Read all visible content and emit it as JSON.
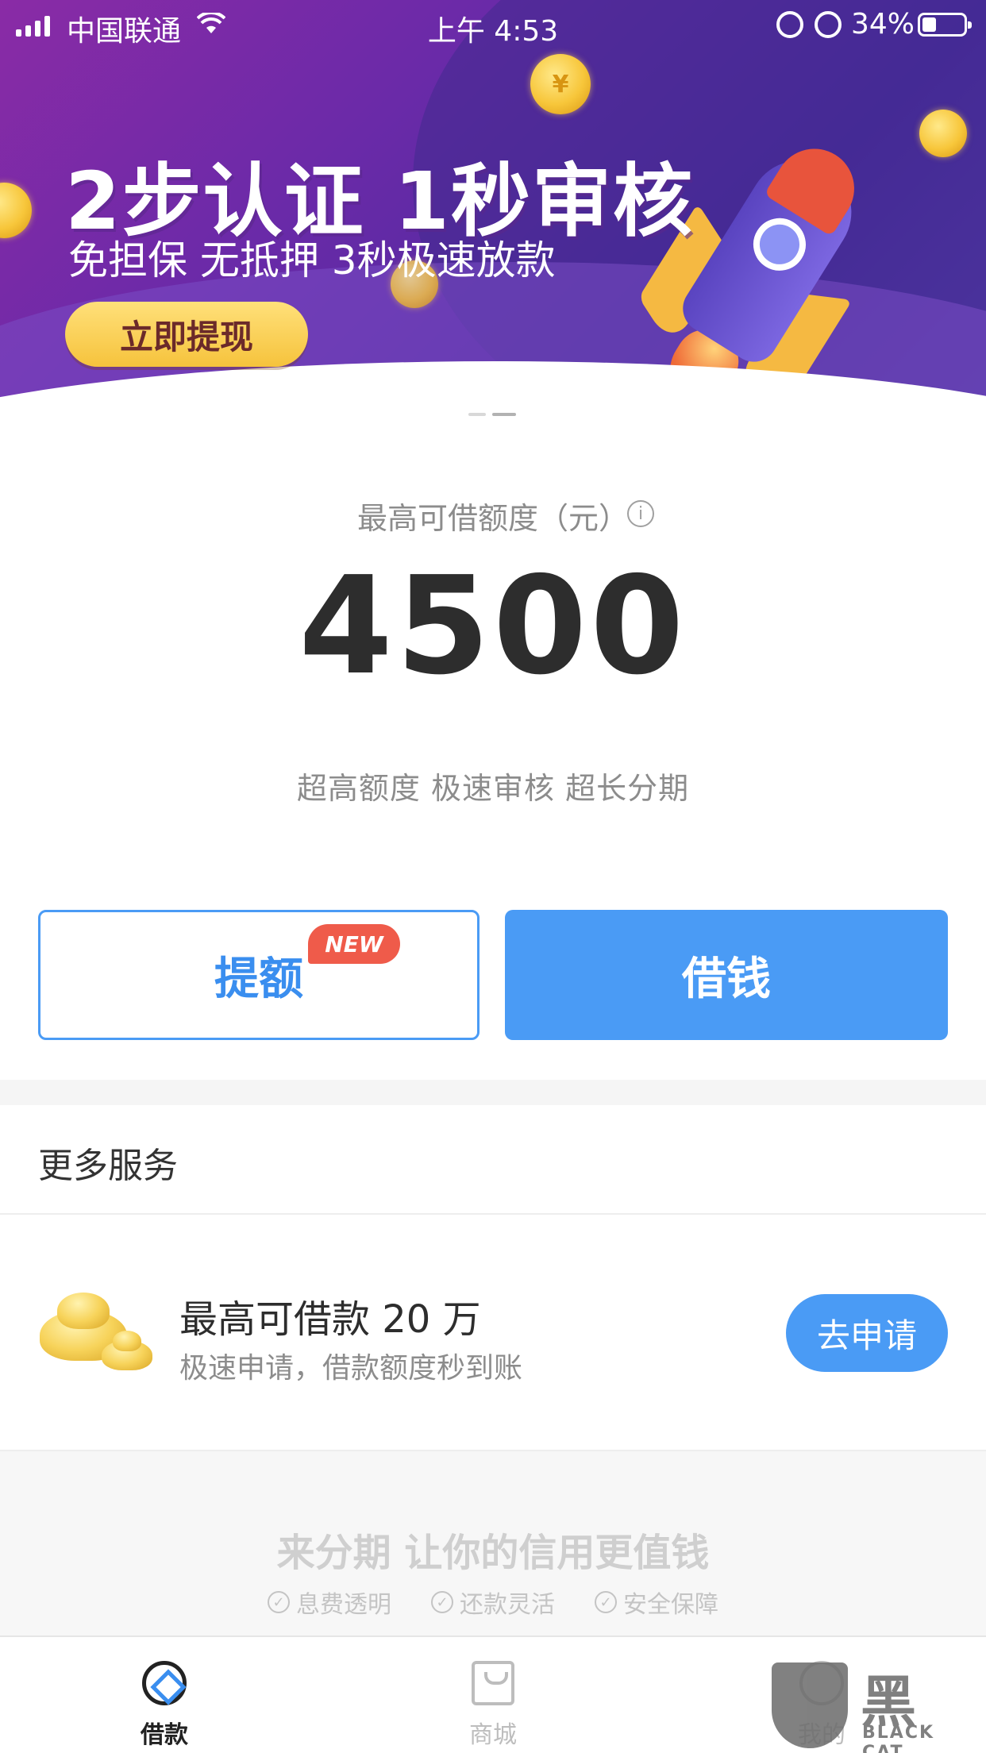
{
  "status_bar": {
    "carrier": "中国联通",
    "time": "上午 4:53",
    "battery_percent": "34%"
  },
  "banner": {
    "title": "2步认证  1秒审核",
    "subtitle": "免担保 无抵押 3秒极速放款",
    "cta_label": "立即提现",
    "coin_symbol": "¥"
  },
  "limit": {
    "label": "最高可借额度（元）",
    "info_symbol": "i",
    "amount": "4500",
    "tagline": "超高额度 极速审核 超长分期"
  },
  "actions": {
    "raise_label": "提额",
    "new_badge": "NEW",
    "borrow_label": "借钱"
  },
  "more_services": {
    "title": "更多服务",
    "item": {
      "title": "最高可借款 20 万",
      "subtitle": "极速申请，借款额度秒到账",
      "button": "去申请"
    }
  },
  "footer": {
    "slogan": "来分期  让你的信用更值钱",
    "features": [
      "息费透明",
      "还款灵活",
      "安全保障"
    ],
    "check_symbol": "✓"
  },
  "tabbar": {
    "tabs": [
      {
        "label": "借款",
        "icon": "loan-icon",
        "active": true
      },
      {
        "label": "商城",
        "icon": "mall-icon",
        "active": false
      },
      {
        "label": "我的",
        "icon": "profile-icon",
        "active": false
      }
    ]
  },
  "watermark": {
    "cn": "黑猫",
    "en": "BLACK CAT"
  },
  "colors": {
    "accent": "#4a9bf5",
    "badge": "#ef5b4a",
    "banner_purple": "#6a2aa8"
  }
}
